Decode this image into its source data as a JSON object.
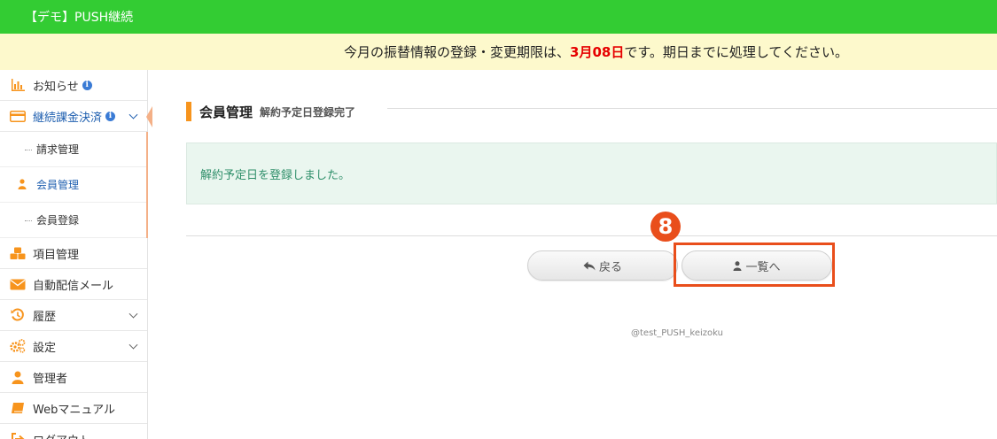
{
  "app": {
    "title": "【デモ】PUSH継続"
  },
  "notice": {
    "prefix": "今月の振替情報の登録・変更期限は、",
    "deadline": "3月08日",
    "suffix": "です。期日までに処理してください。"
  },
  "sidebar": {
    "items": [
      {
        "label": "お知らせ",
        "icon": "chart-icon"
      },
      {
        "label": "継続課金決済",
        "icon": "card-icon"
      },
      {
        "label": "項目管理",
        "icon": "cubes-icon"
      },
      {
        "label": "自動配信メール",
        "icon": "envelope-icon"
      },
      {
        "label": "履歴",
        "icon": "history-icon"
      },
      {
        "label": "設定",
        "icon": "gears-icon"
      },
      {
        "label": "管理者",
        "icon": "user-icon"
      },
      {
        "label": "Webマニュアル",
        "icon": "book-icon"
      },
      {
        "label": "ログアウト",
        "icon": "logout-icon"
      }
    ],
    "subitems": [
      {
        "label": "請求管理"
      },
      {
        "label": "会員管理"
      },
      {
        "label": "会員登録"
      }
    ]
  },
  "main": {
    "title": "会員管理",
    "subtitle": "解約予定日登録完了",
    "alert": "解約予定日を登録しました。",
    "back_label": "戻る",
    "list_label": "一覧へ",
    "step_number": "8",
    "footer": "@test_PUSH_keizoku"
  },
  "colors": {
    "topbar": "#33cc33",
    "notice_bg": "#fdf9cc",
    "deadline": "#e60000",
    "accent_orange": "#f7941d",
    "highlight": "#e94e1b",
    "alert_text": "#2f8f6a"
  }
}
